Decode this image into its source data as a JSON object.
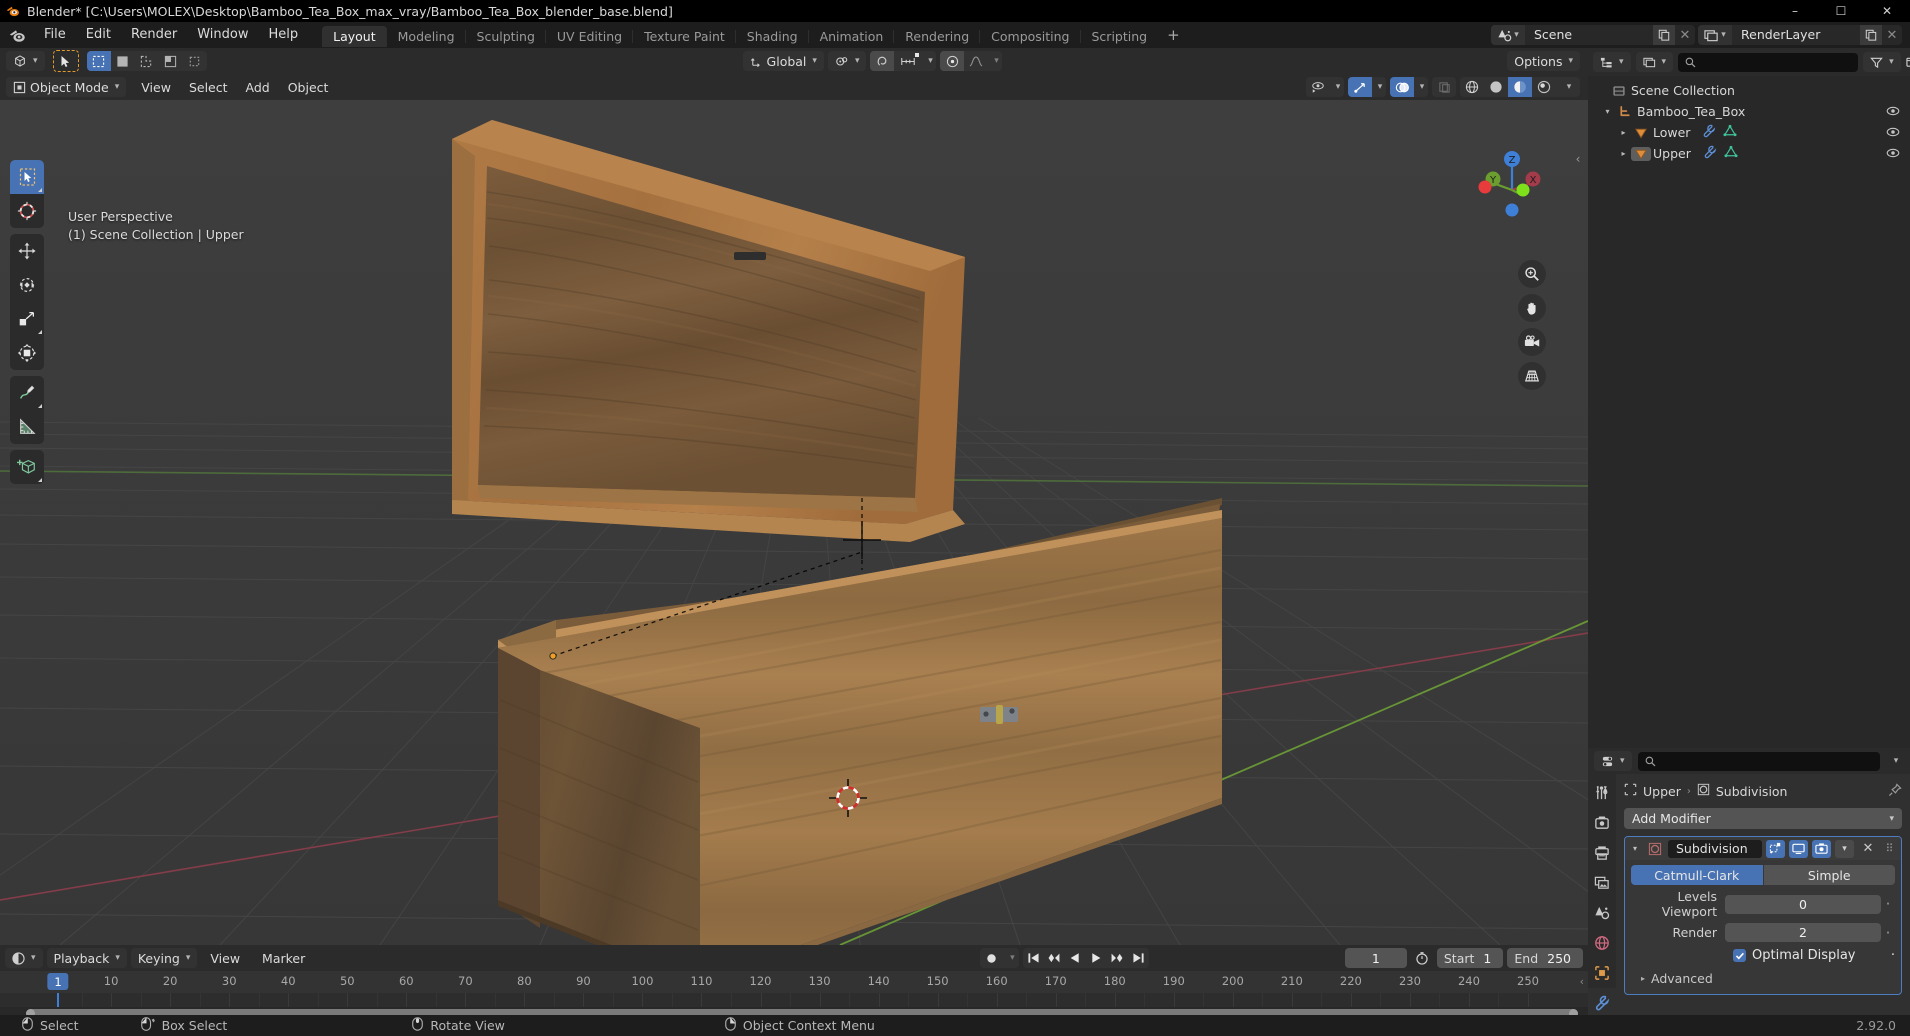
{
  "window": {
    "title": "Blender* [C:\\Users\\MOLEX\\Desktop\\Bamboo_Tea_Box_max_vray/Bamboo_Tea_Box_blender_base.blend]",
    "minimize": "–",
    "maximize": "☐",
    "close": "✕"
  },
  "topbar": {
    "menus": [
      "File",
      "Edit",
      "Render",
      "Window",
      "Help"
    ],
    "workspaces": [
      {
        "label": "Layout",
        "active": true
      },
      {
        "label": "Modeling",
        "active": false
      },
      {
        "label": "Sculpting",
        "active": false
      },
      {
        "label": "UV Editing",
        "active": false
      },
      {
        "label": "Texture Paint",
        "active": false
      },
      {
        "label": "Shading",
        "active": false
      },
      {
        "label": "Animation",
        "active": false
      },
      {
        "label": "Rendering",
        "active": false
      },
      {
        "label": "Compositing",
        "active": false
      },
      {
        "label": "Scripting",
        "active": false
      }
    ],
    "add_workspace": "+",
    "scene": {
      "name": "Scene",
      "icon": "scene-icon"
    },
    "view_layer": {
      "name": "RenderLayer",
      "icon": "view-layer-icon"
    }
  },
  "viewport": {
    "editor_type_icon": "editor-type-3dview-icon",
    "mode": "Object Mode",
    "menus": [
      "View",
      "Select",
      "Add",
      "Object"
    ],
    "transform_orientation": "Global",
    "options_label": "Options",
    "overlay_line1": "User Perspective",
    "overlay_line2": "(1) Scene Collection | Upper",
    "gizmo_axes": [
      "X",
      "Y",
      "Z"
    ],
    "tools": [
      {
        "name": "tweak-select-tool",
        "active": true
      },
      {
        "name": "cursor-tool",
        "active": false
      },
      {
        "name": "move-tool",
        "active": false
      },
      {
        "name": "rotate-tool",
        "active": false
      },
      {
        "name": "scale-tool",
        "active": false
      },
      {
        "name": "transform-tool",
        "active": false
      },
      {
        "name": "annotate-tool",
        "active": false
      },
      {
        "name": "measure-tool",
        "active": false
      },
      {
        "name": "add-cube-tool",
        "active": false
      }
    ]
  },
  "outliner": {
    "display_mode": "view-layer",
    "search_placeholder": "",
    "rows": [
      {
        "label": "Scene Collection",
        "icon": "collection-icon",
        "depth": 0,
        "twisty": "",
        "selected": false,
        "has_eye": false
      },
      {
        "label": "Bamboo_Tea_Box",
        "icon": "collection-child-icon",
        "depth": 1,
        "twisty": "▾",
        "selected": false,
        "has_eye": true
      },
      {
        "label": "Lower",
        "icon": "mesh-object-icon",
        "depth": 2,
        "twisty": "▸",
        "selected": false,
        "has_eye": true,
        "extras": [
          "wrench-icon",
          "mesh-data-icon"
        ]
      },
      {
        "label": "Upper",
        "icon": "mesh-object-icon",
        "depth": 2,
        "twisty": "▸",
        "selected": true,
        "has_eye": true,
        "extras": [
          "wrench-icon",
          "mesh-data-icon"
        ]
      }
    ]
  },
  "properties": {
    "breadcrumb_object": "Upper",
    "breadcrumb_modifier": "Subdivision",
    "breadcrumb_sep": "›",
    "add_modifier": "Add Modifier",
    "modifier": {
      "name": "Subdivision",
      "type_buttons": [
        {
          "label": "Catmull-Clark",
          "active": true
        },
        {
          "label": "Simple",
          "active": false
        }
      ],
      "fields": [
        {
          "label": "Levels Viewport",
          "value": "0"
        },
        {
          "label": "Render",
          "value": "2"
        }
      ],
      "optimal_display": {
        "label": "Optimal Display",
        "checked": true
      },
      "advanced": {
        "label": "Advanced",
        "expanded": false
      }
    },
    "tabs": [
      {
        "name": "tool-tab",
        "icon": "tool-icon",
        "active": false
      },
      {
        "name": "render-tab",
        "icon": "render-camera-icon",
        "active": false
      },
      {
        "name": "output-tab",
        "icon": "printer-icon",
        "active": false
      },
      {
        "name": "view-layer-tab",
        "icon": "images-icon",
        "active": false
      },
      {
        "name": "scene-tab",
        "icon": "scene-cone-icon",
        "active": false
      },
      {
        "name": "world-tab",
        "icon": "world-globe-icon",
        "active": false
      },
      {
        "name": "object-tab",
        "icon": "object-square-icon",
        "active": false
      },
      {
        "name": "modifier-tab",
        "icon": "wrench-icon",
        "active": true
      }
    ]
  },
  "timeline": {
    "editor_icon": "timeline-icon",
    "menus": [
      {
        "label": "Playback",
        "has_chevron": true
      },
      {
        "label": "Keying",
        "has_chevron": true
      },
      {
        "label": "View",
        "has_chevron": false
      },
      {
        "label": "Marker",
        "has_chevron": false
      }
    ],
    "record_icon": "record-icon",
    "transport": [
      "jump-start-icon",
      "prev-keyframe-icon",
      "play-reverse-icon",
      "play-icon",
      "next-keyframe-icon",
      "jump-end-icon"
    ],
    "current_frame": "1",
    "start_label": "Start",
    "start_value": "1",
    "end_label": "End",
    "end_value": "250",
    "ticks": [
      10,
      20,
      30,
      40,
      50,
      60,
      70,
      80,
      90,
      100,
      110,
      120,
      130,
      140,
      150,
      160,
      170,
      180,
      190,
      200,
      210,
      220,
      230,
      240,
      250
    ],
    "playhead_frame": "1"
  },
  "statusbar": {
    "items": [
      {
        "icon": "mouse-left-icon",
        "label": "Select"
      },
      {
        "icon": "mouse-left-drag-icon",
        "label": "Box Select"
      },
      {
        "icon": "mouse-middle-icon",
        "label": "Rotate View"
      },
      {
        "icon": "mouse-right-icon",
        "label": "Object Context Menu"
      }
    ],
    "version": "2.92.0"
  },
  "colors": {
    "accent": "#4772b3",
    "panel_bg": "#303030",
    "header_bg": "#2b2b2b",
    "viewport_bg": "#3b3b3b",
    "x_axis": "#a33b4a",
    "y_axis": "#6b9e2f",
    "z_axis": "#2f71c4",
    "wood_light": "#b07b46",
    "wood_dark": "#6b5033"
  }
}
